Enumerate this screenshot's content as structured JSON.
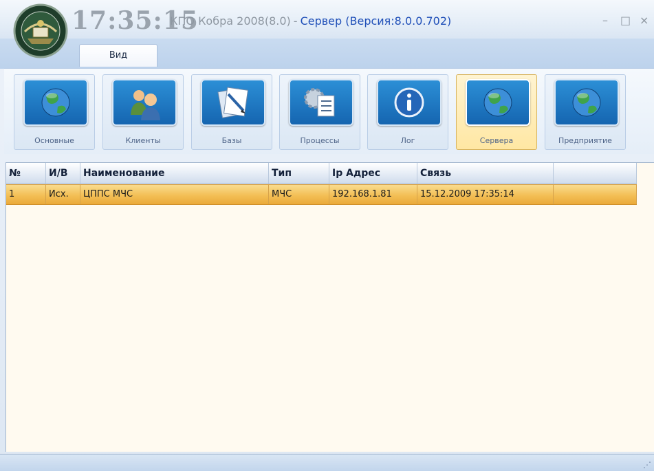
{
  "titlebar": {
    "clock": "17:35:15",
    "app_name": "КПО Кобра 2008(8.0)",
    "separator": "-",
    "server_info": "Сервер (Версия:8.0.0.702)",
    "minimize_glyph": "–",
    "maximize_glyph": "□",
    "close_glyph": "×"
  },
  "ribbon": {
    "tab_label": "Вид",
    "buttons": [
      {
        "label": "Основные",
        "icon": "globe-icon"
      },
      {
        "label": "Клиенты",
        "icon": "users-icon"
      },
      {
        "label": "Базы",
        "icon": "documents-icon"
      },
      {
        "label": "Процессы",
        "icon": "process-icon"
      },
      {
        "label": "Лог",
        "icon": "info-icon"
      },
      {
        "label": "Сервера",
        "icon": "globe-icon",
        "active": true
      },
      {
        "label": "Предприятие",
        "icon": "globe-icon"
      }
    ]
  },
  "grid": {
    "columns": [
      "№",
      "И/В",
      "Наименование",
      "Тип",
      "Ip Адрес",
      "Связь",
      ""
    ],
    "rows": [
      {
        "num": "1",
        "io": "Исх.",
        "name": "ЦППС МЧС",
        "type": "МЧС",
        "ip": "192.168.1.81",
        "link": "15.12.2009 17:35:14",
        "extra": ""
      }
    ]
  },
  "colors": {
    "selected_row": "#f3bf55",
    "accent_blue": "#1f4fb8",
    "ribbon_active": "#ffe7a3"
  },
  "statusbar": {
    "grip_glyph": "⋰"
  }
}
